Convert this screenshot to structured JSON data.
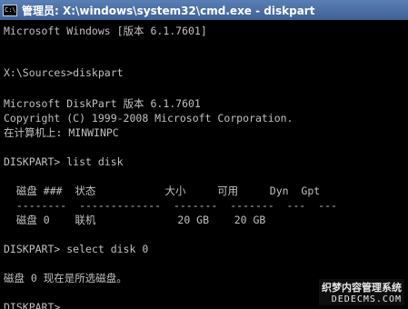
{
  "window": {
    "title": "管理员: X:\\windows\\system32\\cmd.exe - diskpart",
    "icon": "cmd-icon",
    "icon_glyph": "C:\\"
  },
  "console": {
    "lines": [
      "Microsoft Windows [版本 6.1.7601]",
      "",
      "X:\\Sources>diskpart",
      "",
      "Microsoft DiskPart 版本 6.1.7601",
      "Copyright (C) 1999-2008 Microsoft Corporation.",
      "在计算机上: MINWINPC",
      "",
      "DISKPART> list disk",
      "",
      "  磁盘 ###  状态           大小     可用     Dyn  Gpt",
      "  --------  -------------  -------  -------  ---  ---",
      "  磁盘 0    联机             20 GB    20 GB",
      "",
      "DISKPART> select disk 0",
      "",
      "磁盘 0 现在是所选磁盘。",
      "",
      "DISKPART>"
    ]
  },
  "watermark": {
    "top": "织梦内容管理系统",
    "bottom": "DEDECMS.COM"
  }
}
